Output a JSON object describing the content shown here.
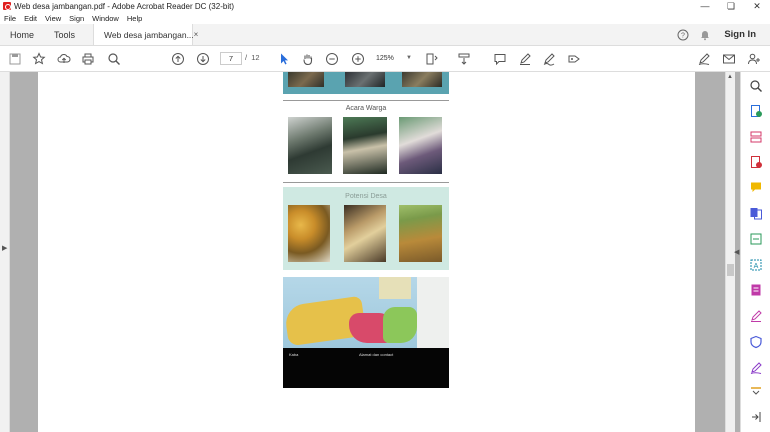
{
  "window": {
    "title": "Web desa jambangan.pdf - Adobe Acrobat Reader DC (32-bit)",
    "controls": [
      "minimize-icon",
      "restore-icon",
      "close-icon"
    ]
  },
  "menu": [
    "File",
    "Edit",
    "View",
    "Sign",
    "Window",
    "Help"
  ],
  "tabs": {
    "home": "Home",
    "tools": "Tools",
    "document": "Web desa jambangan...",
    "close_glyph": "×",
    "sign_in": "Sign In"
  },
  "toolbar": {
    "page_current": "7",
    "page_separator": "/",
    "page_total": "12",
    "zoom": "125%"
  },
  "document": {
    "section_acara": "Acara Warga",
    "section_potensi": "Potensi Desa",
    "footer_left": "Kaba",
    "footer_center": "Alamat dan contact"
  },
  "colors": {
    "accent_blue": "#2a6edb",
    "teal_block": "#5aa3b0",
    "mint_block": "#cfe9e2"
  }
}
